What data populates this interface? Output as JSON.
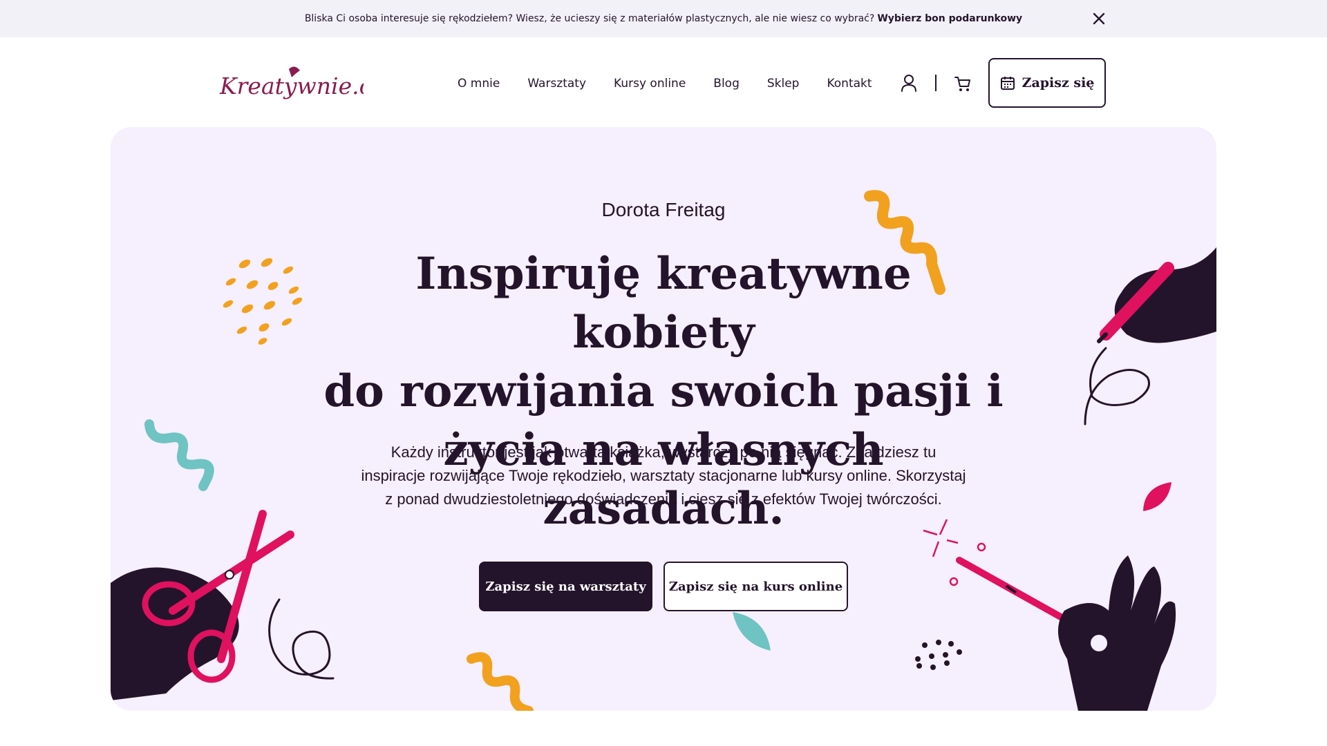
{
  "promo": {
    "text": "Bliska Ci osoba interesuje się rękodziełem? Wiesz, że ucieszy się z materiałów plastycznych, ale nie wiesz co wybrać?",
    "link": "Wybierz bon podarunkowy",
    "close_icon": "close-icon"
  },
  "header": {
    "logo_text": "Kreatywnie.com",
    "nav": [
      "O mnie",
      "Warsztaty",
      "Kursy online",
      "Blog",
      "Sklep",
      "Kontakt"
    ],
    "user_icon": "user-icon",
    "cart_icon": "cart-icon",
    "signup_label": "Zapisz się",
    "signup_icon": "calendar-icon"
  },
  "hero": {
    "name": "Dorota Freitag",
    "title_lines": [
      "Inspiruję kreatywne kobiety",
      "do rozwijania swoich pasji i",
      "życia na własnych zasadach."
    ],
    "description": "Każdy instruktor jest jak otwarta książka, wystarczy po nią sięgnąć. Znajdziesz tu inspiracje rozwijające Twoje rękodzieło, warsztaty stacjonarne lub kursy online. Skorzystaj z ponad dwudziestoletniego doświadczenia i ciesz się z efektów Twojej twórczości.",
    "cta_primary": "Zapisz się na warsztaty",
    "cta_secondary": "Zapisz się na kurs online"
  },
  "colors": {
    "dark": "#24142b",
    "hero_bg": "#f6effd",
    "promo_bg": "#f3f1f8",
    "brand": "#8a1c4f",
    "accent_pink": "#e0115f",
    "accent_orange": "#f2a11f",
    "accent_teal": "#6fc3c3"
  }
}
